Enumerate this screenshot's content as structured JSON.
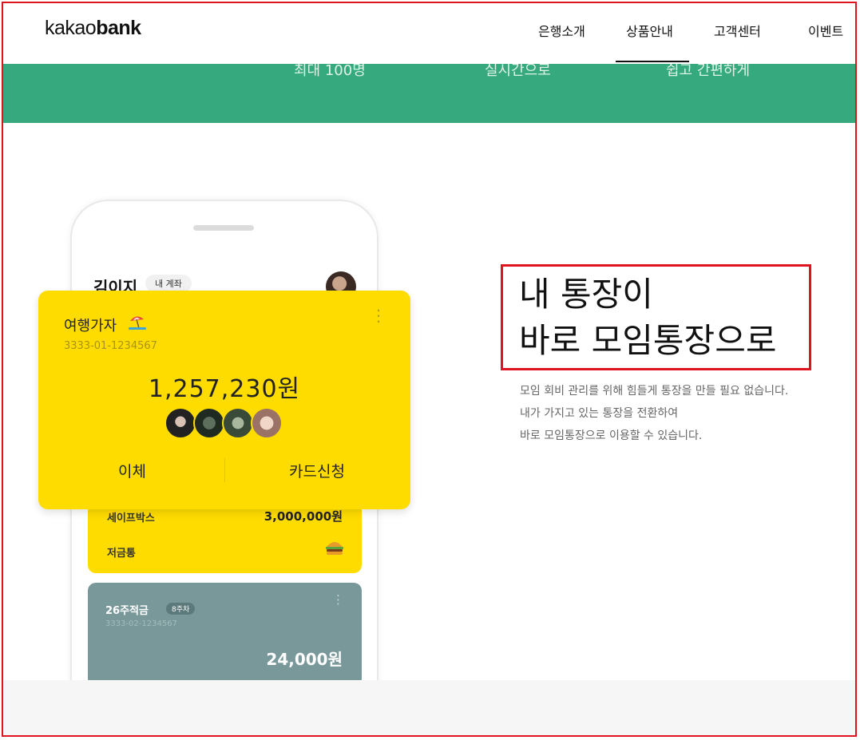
{
  "header": {
    "logo_light": "kakao",
    "logo_bold": "bank",
    "nav": [
      "은행소개",
      "상품안내",
      "고객센터",
      "이벤트"
    ],
    "active_nav": "상품안내"
  },
  "features": [
    "최대 100명",
    "실시간으로",
    "쉽고 간편하게"
  ],
  "phone": {
    "user_name": "김이지",
    "account_chip": "내 계좌",
    "safebox_label": "세이프박스",
    "safebox_amount": "3,000,000원",
    "piggy_label": "저금통",
    "savings": {
      "title": "26주적금",
      "week_chip": "8주차",
      "account": "3333-02-1234567",
      "amount": "24,000원"
    }
  },
  "card": {
    "title": "여행가자",
    "account": "3333-01-1234567",
    "balance": "1,257,230원",
    "transfer_button": "이체",
    "card_apply_button": "카드신청",
    "member_count": 4
  },
  "hero": {
    "headline_line1": "내 통장이",
    "headline_line2": "바로 모임통장으로",
    "desc_line1": "모임 회비 관리를 위해 힘들게 통장을 만들 필요 없습니다.",
    "desc_line2": "내가 가지고 있는 통장을 전환하여",
    "desc_line3": "바로 모임통장으로 이용할 수 있습니다."
  },
  "colors": {
    "brand_green": "#36a97e",
    "kakao_yellow": "#ffdc00",
    "savings_gray": "#78989a",
    "highlight_red": "#e0141e"
  }
}
